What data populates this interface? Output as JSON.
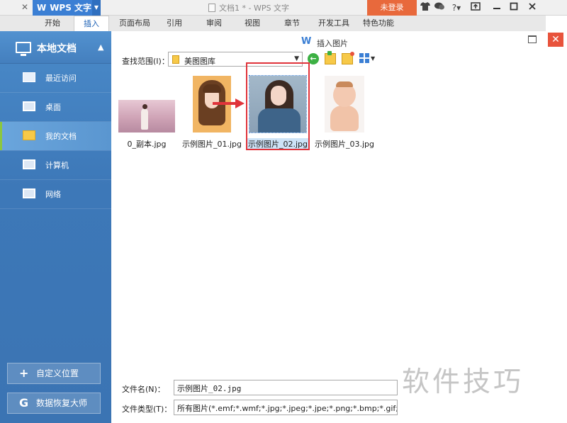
{
  "titlebar": {
    "close_glyph": "✕",
    "app_name": "WPS 文字",
    "app_logo": "W",
    "doc_title": "文档1 * - WPS 文字",
    "login_label": "未登录",
    "help_label": "?",
    "icons": [
      "shirt-icon",
      "chat-icon",
      "help-icon",
      "screen-icon",
      "minimize-icon",
      "maximize-icon",
      "close-icon"
    ]
  },
  "ribbon": {
    "tabs": [
      "开始",
      "插入",
      "页面布局",
      "引用",
      "审阅",
      "视图",
      "章节",
      "开发工具",
      "特色功能"
    ],
    "active_tab": "插入"
  },
  "sidebar": {
    "header_label": "本地文档",
    "items": [
      {
        "label": "最近访问",
        "icon": "recent-icon"
      },
      {
        "label": "桌面",
        "icon": "desktop-icon"
      },
      {
        "label": "我的文档",
        "icon": "folder-icon"
      },
      {
        "label": "计算机",
        "icon": "computer-icon"
      },
      {
        "label": "网络",
        "icon": "network-icon"
      }
    ],
    "active_item": "我的文档",
    "custom_location_label": "自定义位置",
    "recovery_label": "数据恢复大师"
  },
  "dialog": {
    "logo": "W",
    "title": "插入图片",
    "lookin_label": "查找范围(I)：",
    "lookin_value": "美图图库",
    "back_glyph": "←",
    "files": [
      {
        "name": "0_副本.jpg"
      },
      {
        "name": "示例图片_01.jpg"
      },
      {
        "name": "示例图片_02.jpg"
      },
      {
        "name": "示例图片_03.jpg"
      }
    ],
    "selected_file": "示例图片_02.jpg",
    "filename_label": "文件名(N)：",
    "filename_value": "示例图片_02.jpg",
    "filetype_label": "文件类型(T)：",
    "filetype_value": "所有图片(*.emf;*.wmf;*.jpg;*.jpeg;*.jpe;*.png;*.bmp;*.gif;*.tif;*.tiff;*"
  },
  "watermark": "软件技巧",
  "colors": {
    "brand_blue": "#3b7fd4",
    "login_orange": "#e8693c",
    "highlight_red": "#e0333a",
    "sidebar_blue": "#3d78b8",
    "active_marker_green": "#8cc63f"
  }
}
